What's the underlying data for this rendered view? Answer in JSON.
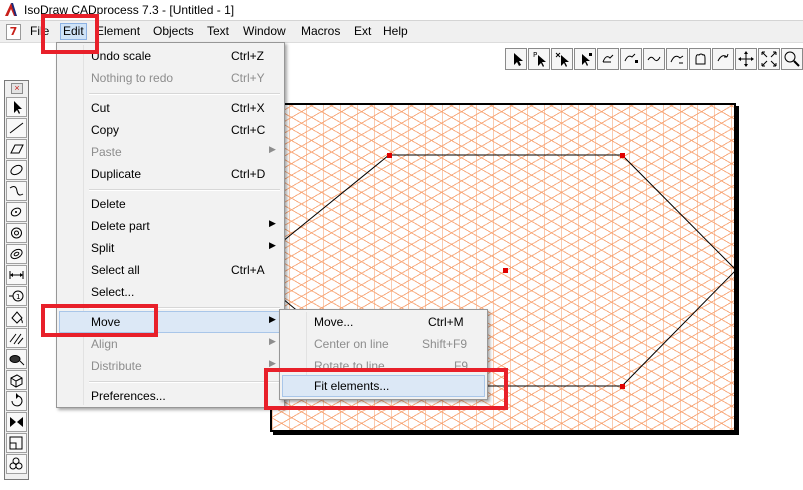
{
  "window": {
    "title": "IsoDraw CADprocess 7.3 - [Untitled - 1]",
    "doc_icon": "7"
  },
  "menubar": {
    "items": [
      "File",
      "Edit",
      "Element",
      "Objects",
      "Text",
      "Window",
      "Macros",
      "Ext",
      "Help"
    ]
  },
  "edit_menu": {
    "undo": {
      "label": "Undo scale",
      "shortcut": "Ctrl+Z"
    },
    "redo": {
      "label": "Nothing to redo",
      "shortcut": "Ctrl+Y"
    },
    "cut": {
      "label": "Cut",
      "shortcut": "Ctrl+X"
    },
    "copy": {
      "label": "Copy",
      "shortcut": "Ctrl+C"
    },
    "paste": {
      "label": "Paste"
    },
    "duplicate": {
      "label": "Duplicate",
      "shortcut": "Ctrl+D"
    },
    "delete": {
      "label": "Delete"
    },
    "delete_part": {
      "label": "Delete part"
    },
    "split": {
      "label": "Split"
    },
    "select_all": {
      "label": "Select all",
      "shortcut": "Ctrl+A"
    },
    "select": {
      "label": "Select..."
    },
    "move": {
      "label": "Move"
    },
    "align": {
      "label": "Align"
    },
    "distribute": {
      "label": "Distribute"
    },
    "preferences": {
      "label": "Preferences..."
    }
  },
  "move_submenu": {
    "move": {
      "label": "Move...",
      "shortcut": "Ctrl+M"
    },
    "center_on_line": {
      "label": "Center on line",
      "shortcut": "Shift+F9"
    },
    "rotate_to_line": {
      "label": "Rotate to line",
      "shortcut": "F9"
    },
    "fit_elements": {
      "label": "Fit elements..."
    }
  },
  "colors": {
    "callout": "#e8202a",
    "grid": "#f7a06e",
    "handle": "#e00000",
    "menu_highlight": "#dce8f6"
  }
}
